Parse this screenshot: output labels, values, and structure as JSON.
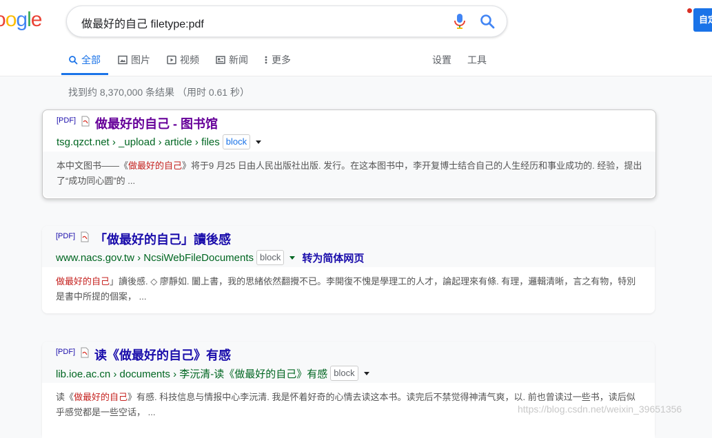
{
  "search": {
    "query": "做最好的自己 filetype:pdf"
  },
  "header": {
    "logo_letters": [
      "o",
      "o",
      "g",
      "l",
      "e"
    ],
    "corner_button": "自定"
  },
  "tabs": [
    {
      "label": "全部",
      "icon": "search-icon",
      "active": true
    },
    {
      "label": "图片",
      "icon": "image-icon"
    },
    {
      "label": "视频",
      "icon": "video-icon"
    },
    {
      "label": "新闻",
      "icon": "news-icon"
    },
    {
      "label": "更多",
      "icon": "more-icon"
    }
  ],
  "tools": {
    "settings": "设置",
    "tools": "工具"
  },
  "stats": "找到约 8,370,000 条结果 （用时 0.61 秒）",
  "results": [
    {
      "pdf_tag": "[PDF]",
      "title": "做最好的自己 - 图书馆",
      "url": "tsg.qzct.net › _upload › article › files",
      "block": "block",
      "snippet_pre": "本中文图书——《",
      "snippet_hl": "做最好的自己",
      "snippet_post": "》将于9 月25 日由人民出版社出版. 发行。在这本图书中，李开复博士结合自己的人生经历和事业成功的. 经验，提出了“成功同心圆”的 ..."
    },
    {
      "pdf_tag": "[PDF]",
      "title": "「做最好的自己」讀後感",
      "url": "www.nacs.gov.tw › NcsiWebFileDocuments",
      "block": "block",
      "convert": "转为简体网页",
      "snippet_pre": "",
      "snippet_hl": "做最好的自己",
      "snippet_post": "」讀後感. ◇ 廖靜如. 闔上書，我的思緒依然翻攪不已。李開復不愧是學理工的人才，論起理來有條. 有理，邏輯清晰，言之有物，特別是書中所提的個案， ..."
    },
    {
      "pdf_tag": "[PDF]",
      "title": "读《做最好的自己》有感",
      "url": "lib.ioe.ac.cn › documents › 李沅清-读《做最好的自己》有感",
      "block": "block",
      "snippet_pre": "读《",
      "snippet_hl": "做最好的自己",
      "snippet_post": "》有感. 科技信息与情报中心李沅清. 我是怀着好奇的心情去读这本书。读完后不禁觉得神清气爽，以. 前也曾读过一些书，读后似乎感觉都是一些空话， ..."
    }
  ],
  "watermark": "https://blog.csdn.net/weixin_39651356"
}
